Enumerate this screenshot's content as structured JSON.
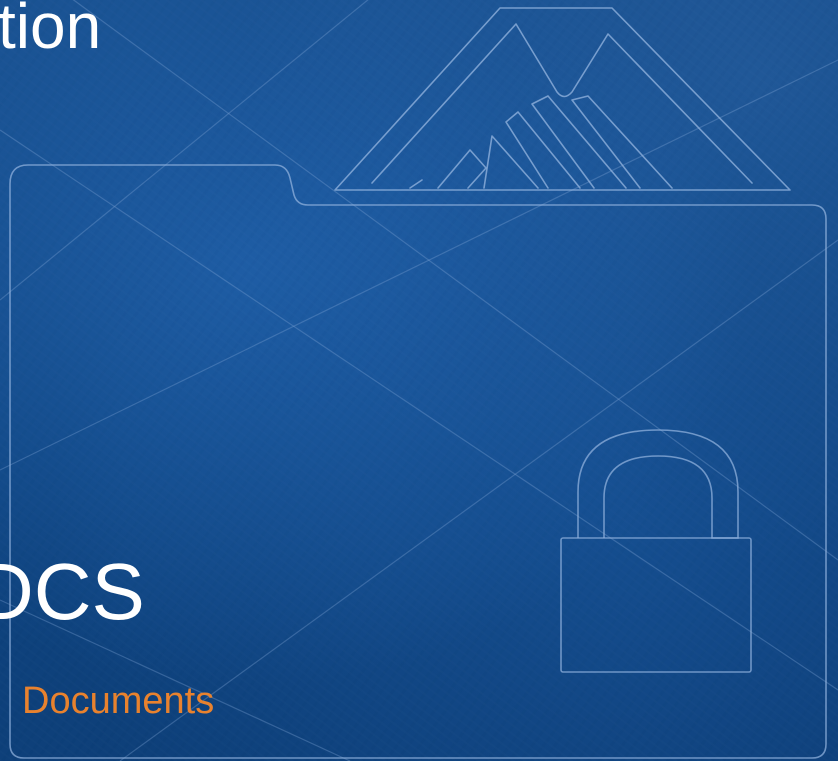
{
  "heading_top": "tion",
  "heading_bottom": "DCS",
  "subtitle": "Documents",
  "colors": {
    "background": "#0f4480",
    "line_art": "#8fb0dc",
    "heading": "#ffffff",
    "subtitle": "#e8822e"
  },
  "icons": [
    "folder-outline-icon",
    "mountain-logo-icon",
    "padlock-icon"
  ]
}
